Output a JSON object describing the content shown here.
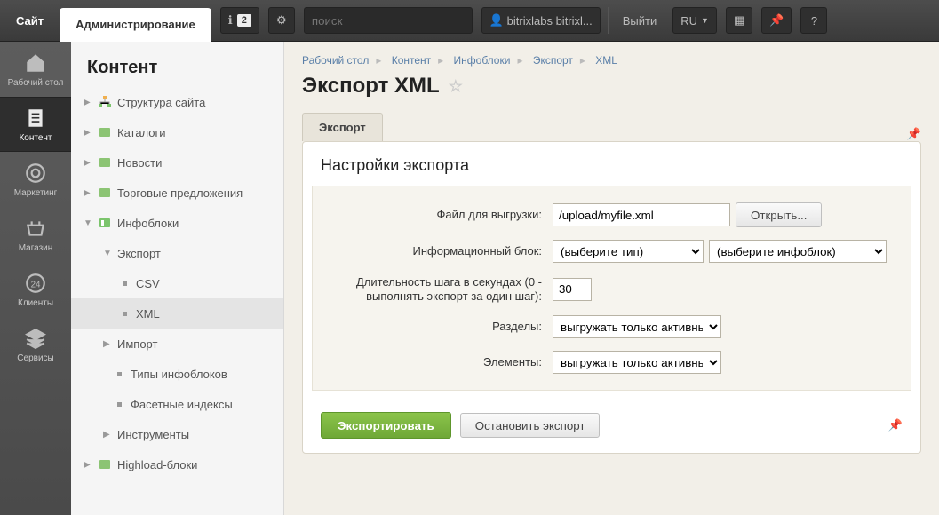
{
  "topbar": {
    "site_tab": "Сайт",
    "admin_tab": "Администрирование",
    "notif_count": "2",
    "search_placeholder": "поиск",
    "user_label": "bitrixlabs bitrixl...",
    "logout": "Выйти",
    "lang": "RU"
  },
  "rail": [
    {
      "label": "Рабочий стол"
    },
    {
      "label": "Контент"
    },
    {
      "label": "Маркетинг"
    },
    {
      "label": "Магазин"
    },
    {
      "label": "Клиенты"
    },
    {
      "label": "Сервисы"
    }
  ],
  "sidebar": {
    "title": "Контент",
    "items": {
      "structure": "Структура сайта",
      "catalogs": "Каталоги",
      "news": "Новости",
      "offers": "Торговые предложения",
      "iblocks": "Инфоблоки",
      "export": "Экспорт",
      "csv": "CSV",
      "xml": "XML",
      "import": "Импорт",
      "ibtypes": "Типы инфоблоков",
      "facet": "Фасетные индексы",
      "tools": "Инструменты",
      "highload": "Highload-блоки"
    }
  },
  "breadcrumbs": [
    "Рабочий стол",
    "Контент",
    "Инфоблоки",
    "Экспорт",
    "XML"
  ],
  "page": {
    "title": "Экспорт XML",
    "tab_export": "Экспорт",
    "panel_title": "Настройки экспорта",
    "labels": {
      "file": "Файл для выгрузки:",
      "iblock": "Информационный блок:",
      "step": "Длительность шага в секундах (0 - выполнять экспорт за один шаг):",
      "sections": "Разделы:",
      "elements": "Элементы:"
    },
    "values": {
      "file": "/upload/myfile.xml",
      "type_placeholder": "(выберите тип)",
      "iblock_placeholder": "(выберите инфоблок)",
      "step": "30",
      "sections_sel": "выгружать только активные",
      "elements_sel": "выгружать только активные"
    },
    "buttons": {
      "open": "Открыть...",
      "export": "Экспортировать",
      "stop": "Остановить экспорт"
    }
  }
}
